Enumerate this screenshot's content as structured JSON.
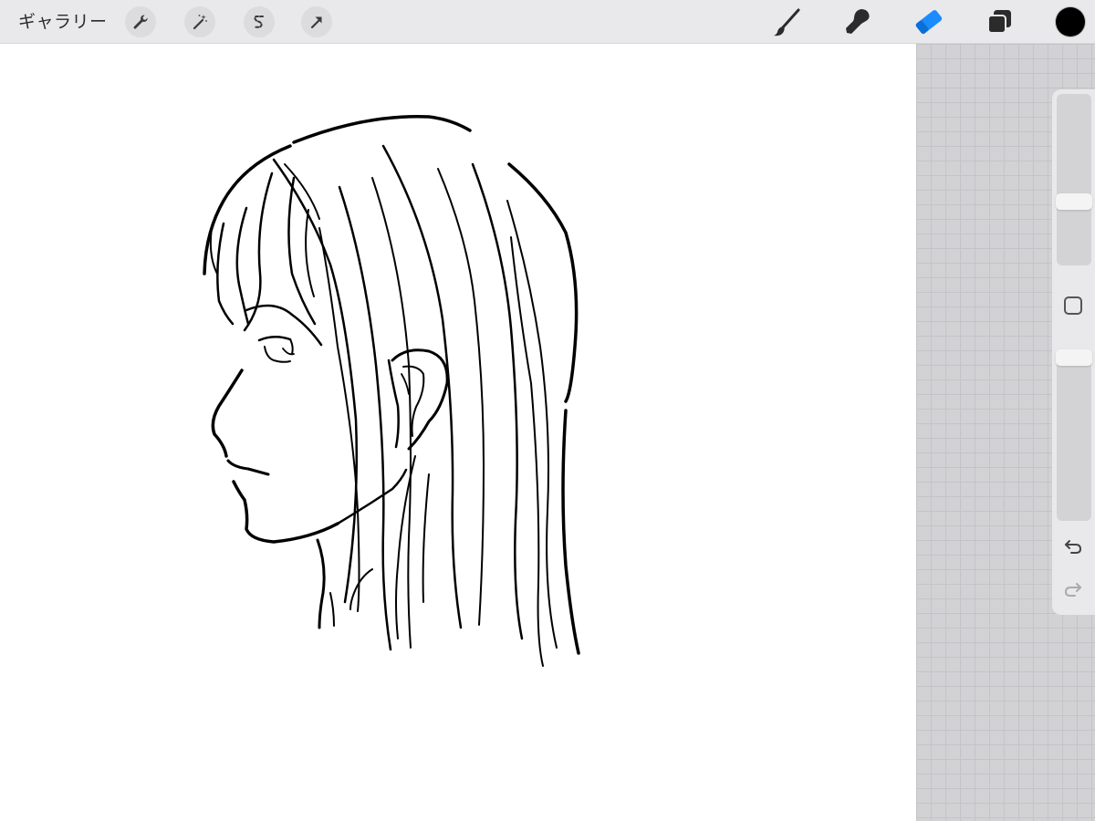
{
  "toolbar": {
    "gallery_label": "ギャラリー",
    "left_tools": [
      {
        "name": "actions",
        "icon": "wrench-icon"
      },
      {
        "name": "adjustments",
        "icon": "magic-wand-icon"
      },
      {
        "name": "selection",
        "icon": "selection-s-icon"
      },
      {
        "name": "transform",
        "icon": "arrow-cursor-icon"
      }
    ],
    "right_tools": [
      {
        "name": "brush",
        "icon": "brush-icon",
        "active": false
      },
      {
        "name": "smudge",
        "icon": "smudge-icon",
        "active": false
      },
      {
        "name": "eraser",
        "icon": "eraser-icon",
        "active": true
      },
      {
        "name": "layers",
        "icon": "layers-icon",
        "active": false
      }
    ],
    "current_color": "#000000",
    "accent_color": "#1a8cff"
  },
  "sidebar": {
    "brush_size_level": 0.6,
    "opacity_level": 1.0,
    "modifier_icon": "square-modifier-icon",
    "undo_icon": "undo-icon",
    "redo_icon": "redo-icon",
    "redo_enabled": false
  },
  "canvas": {
    "background": "#ffffff",
    "content": "line-art-illustration"
  }
}
